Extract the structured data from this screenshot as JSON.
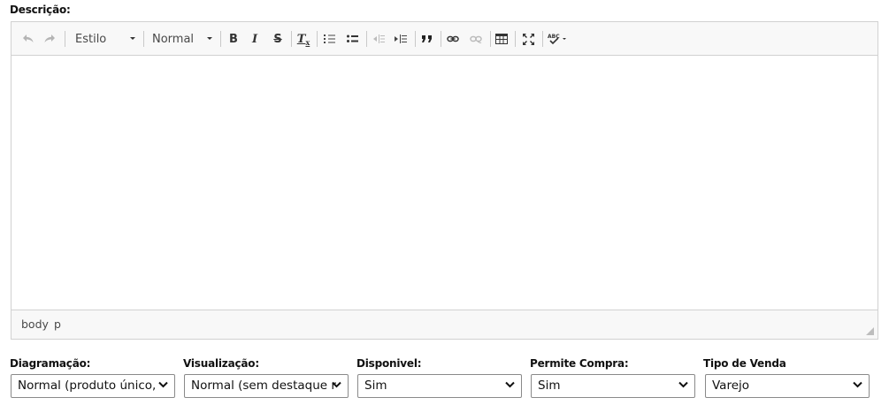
{
  "description_label": "Descrição:",
  "toolbar": {
    "undo_icon": "undo-icon",
    "redo_icon": "redo-icon",
    "style_combo": "Estilo",
    "format_combo": "Normal",
    "bold_label": "B",
    "italic_label": "I",
    "strike_label": "S",
    "remove_format_label": "T",
    "remove_format_sub": "x",
    "buttons": [
      "undo",
      "redo",
      "bold",
      "italic",
      "strikethrough",
      "remove-format",
      "numbered-list",
      "bulleted-list",
      "outdent",
      "indent",
      "blockquote",
      "link",
      "unlink",
      "table",
      "maximize",
      "spellcheck"
    ]
  },
  "statusbar": {
    "path_body": "body",
    "path_p": "p"
  },
  "fields": [
    {
      "label": "Diagramação:",
      "value": "Normal (produto único,"
    },
    {
      "label": "Visualização:",
      "value": "Normal (sem destaque r"
    },
    {
      "label": "Disponivel:",
      "value": "Sim"
    },
    {
      "label": "Permite Compra:",
      "value": "Sim"
    },
    {
      "label": "Tipo de Venda",
      "value": "Varejo"
    }
  ]
}
